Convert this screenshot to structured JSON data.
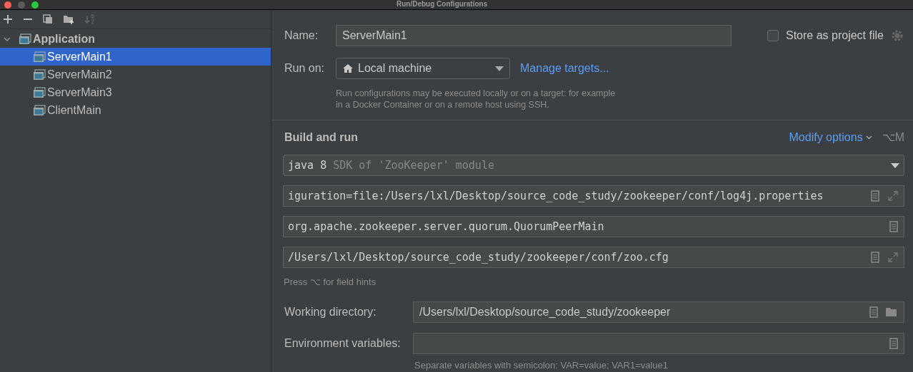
{
  "window": {
    "title": "Run/Debug Configurations"
  },
  "tree": [
    {
      "label": "Application",
      "expanded": true,
      "selected": false,
      "children": [
        {
          "label": "ServerMain1",
          "selected": true
        },
        {
          "label": "ServerMain2",
          "selected": false
        },
        {
          "label": "ServerMain3",
          "selected": false
        },
        {
          "label": "ClientMain",
          "selected": false
        }
      ]
    }
  ],
  "form": {
    "name": {
      "label": "Name:",
      "value": "ServerMain1"
    },
    "store_as_project_file": {
      "label": "Store as project file",
      "checked": false
    },
    "run_on": {
      "label": "Run on:",
      "value": "Local machine",
      "link": "Manage targets..."
    },
    "run_on_note": [
      "Run configurations may be executed locally or on a target: for example",
      "in a Docker Container or on a remote host using SSH."
    ],
    "build_and_run": {
      "title": "Build and run",
      "modify_options": "Modify options",
      "shortcut": "⌥M",
      "sdk": {
        "value": "java 8",
        "hint": "SDK of 'ZooKeeper' module"
      },
      "fields": [
        {
          "value": "iguration=file:/Users/lxl/Desktop/source_code_study/zookeeper/conf/log4j.properties",
          "expandable": true
        },
        {
          "value": "org.apache.zookeeper.server.quorum.QuorumPeerMain",
          "expandable": false
        },
        {
          "value": "/Users/lxl/Desktop/source_code_study/zookeeper/conf/zoo.cfg",
          "expandable": true
        }
      ],
      "field_hint": "Press ⌥ for field hints"
    },
    "working_directory": {
      "label": "Working directory:",
      "value": "/Users/lxl/Desktop/source_code_study/zookeeper"
    },
    "environment_variables": {
      "label": "Environment variables:",
      "hint": "Separate variables with semicolon: VAR=value; VAR1=value1"
    }
  }
}
